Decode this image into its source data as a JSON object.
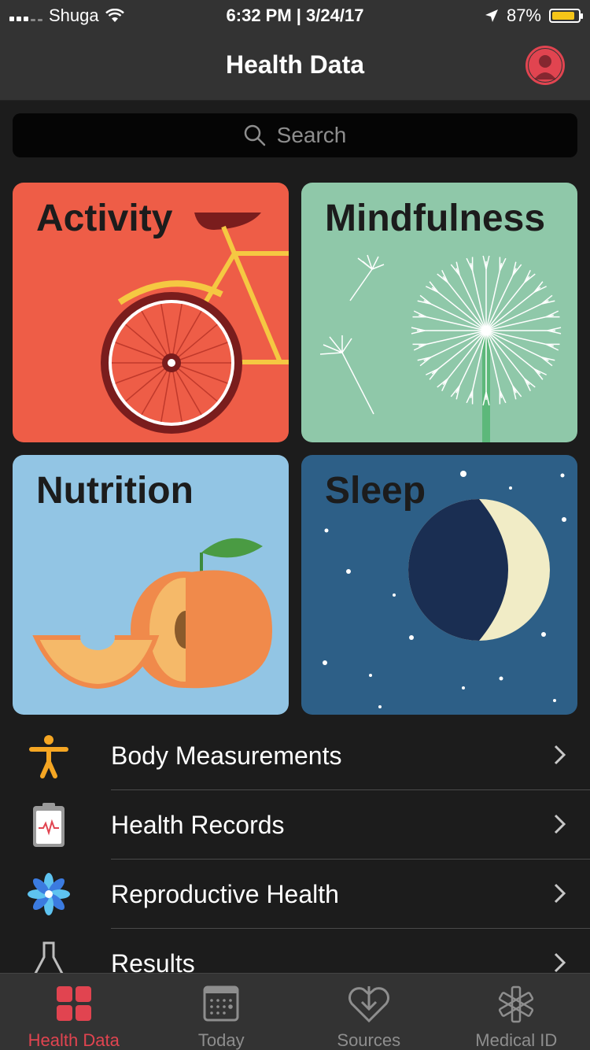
{
  "status_bar": {
    "carrier": "Shuga",
    "time_date": "6:32 PM | 3/24/17",
    "battery_percent": "87%",
    "battery_level": 0.87,
    "battery_color": "#f5c518"
  },
  "header": {
    "title": "Health Data",
    "profile_icon": "person-circle-icon"
  },
  "search": {
    "placeholder": "Search",
    "icon": "search-icon"
  },
  "tiles": [
    {
      "label": "Activity",
      "color": "#ee5d47",
      "icon": "bicycle-illustration"
    },
    {
      "label": "Mindfulness",
      "color": "#8fc8a9",
      "icon": "dandelion-illustration"
    },
    {
      "label": "Nutrition",
      "color": "#92c5e4",
      "icon": "peach-illustration"
    },
    {
      "label": "Sleep",
      "color": "#2d5f87",
      "icon": "moon-stars-illustration"
    }
  ],
  "list": [
    {
      "label": "Body Measurements",
      "icon": "person-figure-icon"
    },
    {
      "label": "Health Records",
      "icon": "clipboard-icon"
    },
    {
      "label": "Reproductive Health",
      "icon": "flower-icon"
    },
    {
      "label": "Results",
      "icon": "flask-icon"
    }
  ],
  "tab_bar": {
    "active_color": "#e14450",
    "tabs": [
      {
        "label": "Health Data",
        "icon": "grid-icon",
        "active": true
      },
      {
        "label": "Today",
        "icon": "calendar-icon",
        "active": false
      },
      {
        "label": "Sources",
        "icon": "heart-download-icon",
        "active": false
      },
      {
        "label": "Medical ID",
        "icon": "asterisk-icon",
        "active": false
      }
    ]
  }
}
